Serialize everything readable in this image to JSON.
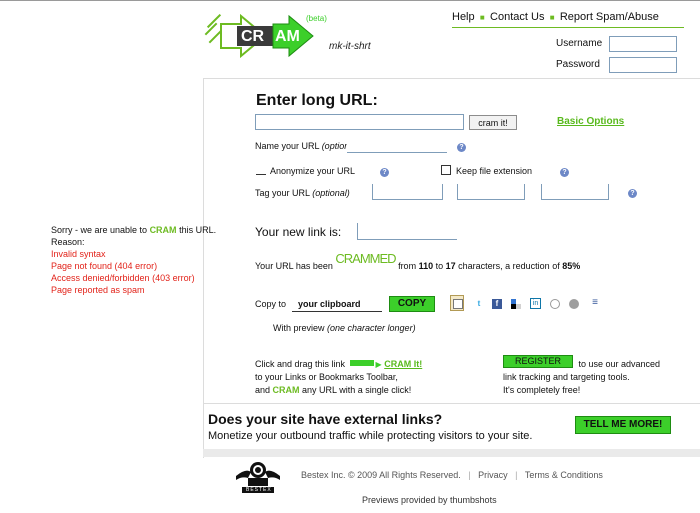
{
  "header": {
    "brand_left": "CR",
    "brand_right": "AM",
    "beta": "(beta)",
    "tagline": "mk-it-shrt",
    "nav": [
      {
        "label": "Help"
      },
      {
        "label": "Contact Us"
      },
      {
        "label": "Report Spam/Abuse"
      }
    ],
    "username_label": "Username",
    "password_label": "Password"
  },
  "form": {
    "heading": "Enter long URL:",
    "cram_button": "cram it!",
    "basic_options": "Basic Options",
    "name_label": "Name your URL ",
    "name_optional": "(optional)",
    "anonymize_label": "Anonymize your URL",
    "keep_ext_label": "Keep file extension",
    "tag_label": "Tag your URL ",
    "tag_optional": "(optional)"
  },
  "result": {
    "new_link_label": "Your new link is:",
    "summary_prefix": "Your URL has been ",
    "crammed": "CRAMMED",
    "summary_mid": " from ",
    "from_count": "110",
    "to_word": " to ",
    "to_count": "17",
    "summary_suffix": " characters, a reduction of ",
    "reduction": "85%",
    "copy_to": "Copy to",
    "clipboard_value": "your clipboard",
    "copy_button": "COPY",
    "preview_label": "With preview ",
    "preview_note": "(one character longer)"
  },
  "errors": {
    "intro_prefix": "Sorry - we are unable to ",
    "intro_cram": "CRAM",
    "intro_suffix": " this URL.",
    "reason": "Reason:",
    "items": [
      "Invalid syntax",
      "Page not found (404 error)",
      "Access denied/forbidden (403 error)",
      "Page reported as spam"
    ]
  },
  "promo": {
    "drag_line1": "Click and drag this link ",
    "drag_link": "CRAM It!",
    "drag_line2": "to your Links or Bookmarks Toolbar,",
    "drag_line3_prefix": "and ",
    "drag_line3_cram": "CRAM",
    "drag_line3_suffix": " any URL with a single click!",
    "register_button": "REGISTER",
    "register_line1": " to use our advanced",
    "register_line2": "link tracking and targeting tools.",
    "register_line3": "It's completely free!"
  },
  "external": {
    "heading": "Does your site have external links?",
    "sub": "Monetize your outbound traffic while protecting visitors to your site.",
    "button": "TELL ME MORE!"
  },
  "footer": {
    "logo_text": "BESTEX",
    "copyright": "Bestex Inc. © 2009 All Rights Reserved.",
    "privacy": "Privacy",
    "terms": "Terms & Conditions",
    "previews": "Previews provided by thumbshots"
  },
  "colors": {
    "accent_green": "#6dbb22",
    "button_green": "#3ccf2a",
    "error_red": "#e2231a",
    "help_blue": "#6d88c7"
  },
  "icons": [
    "clipboard-icon",
    "twitter-icon",
    "facebook-icon",
    "delicious-icon",
    "linkedin-icon",
    "digg-icon",
    "stumbleupon-icon",
    "friendfeed-icon"
  ]
}
